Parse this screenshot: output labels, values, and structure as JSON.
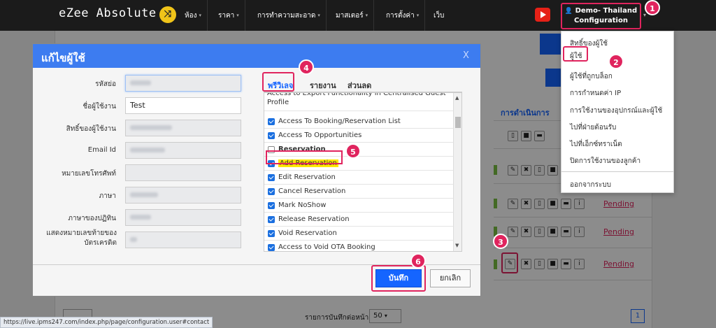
{
  "header": {
    "brand": "eZee Absolute",
    "nav": [
      "ห้อง",
      "ราคา",
      "การทำความสะอาด",
      "มาสเตอร์",
      "การตั้งค่า",
      "เว็บ"
    ],
    "user_line1": "Demo- Thailand",
    "user_line2": "Configuration"
  },
  "user_menu": {
    "items": [
      "สิทธิ์ของผู้ใช้",
      "ผู้ใช้",
      "ผู้ใช้ที่ถูกบล็อก",
      "การกำหนดค่า IP",
      "การใช้งานของอุปกรณ์และผู้ใช้",
      "ไปที่ฝ่ายต้อนรับ",
      "ไปที่เอ็กซ์ทราเน็ต",
      "ปิดการใช้งานของลูกค้า"
    ],
    "logout": "ออกจากระบบ"
  },
  "background": {
    "actions_header": "การดำเนินการ",
    "pending": [
      "Pending",
      "Pending",
      "Pending"
    ],
    "per_page_label": "รายการบันทึกต่อหน้า",
    "per_page_value": "50",
    "page_number": "1"
  },
  "modal": {
    "title": "แก้ไขผู้ใช้",
    "close": "X",
    "labels": {
      "code": "รหัสย่อ",
      "username": "ชื่อผู้ใช้งาน",
      "user_rights": "สิทธิ์ของผู้ใช้งาน",
      "email": "Email Id",
      "phone": "หมายเลขโทรศัพท์",
      "language": "ภาษา",
      "calendar_language": "ภาษาของปฏิทิน",
      "card_digits": "แสดงหมายเลขท้ายของบัตรเครดิต"
    },
    "username_value": "Test",
    "tabs": [
      "พรีวิเลจ",
      "รายงาน",
      "ส่วนลด"
    ],
    "privileges_top": "Access to Export Functionality in Centralised Guest Profile",
    "privileges": [
      {
        "label": "Access To Booking/Reservation List",
        "checked": true,
        "bold": false
      },
      {
        "label": "Access To Opportunities",
        "checked": true,
        "bold": false
      },
      {
        "label": "Reservation",
        "checked": false,
        "bold": true
      },
      {
        "label": "Add Reservation",
        "checked": true,
        "bold": false
      },
      {
        "label": "Edit Reservation",
        "checked": true,
        "bold": false
      },
      {
        "label": "Cancel Reservation",
        "checked": true,
        "bold": false
      },
      {
        "label": "Mark NoShow",
        "checked": true,
        "bold": false
      },
      {
        "label": "Release Reservation",
        "checked": true,
        "bold": false
      },
      {
        "label": "Void Reservation",
        "checked": true,
        "bold": false
      },
      {
        "label": "Access to Void OTA Booking",
        "checked": true,
        "bold": false
      }
    ],
    "save": "บันทึก",
    "cancel": "ยกเลิก"
  },
  "annotations": [
    "1",
    "2",
    "3",
    "4",
    "5",
    "6"
  ],
  "status_url": "https://live.ipms247.com/index.php/page/configuration.user#contact",
  "colors": {
    "accent": "#1565ff",
    "highlight": "#e0245e",
    "modal_header": "#3d7cf0",
    "topbar": "#1b1b1b"
  }
}
